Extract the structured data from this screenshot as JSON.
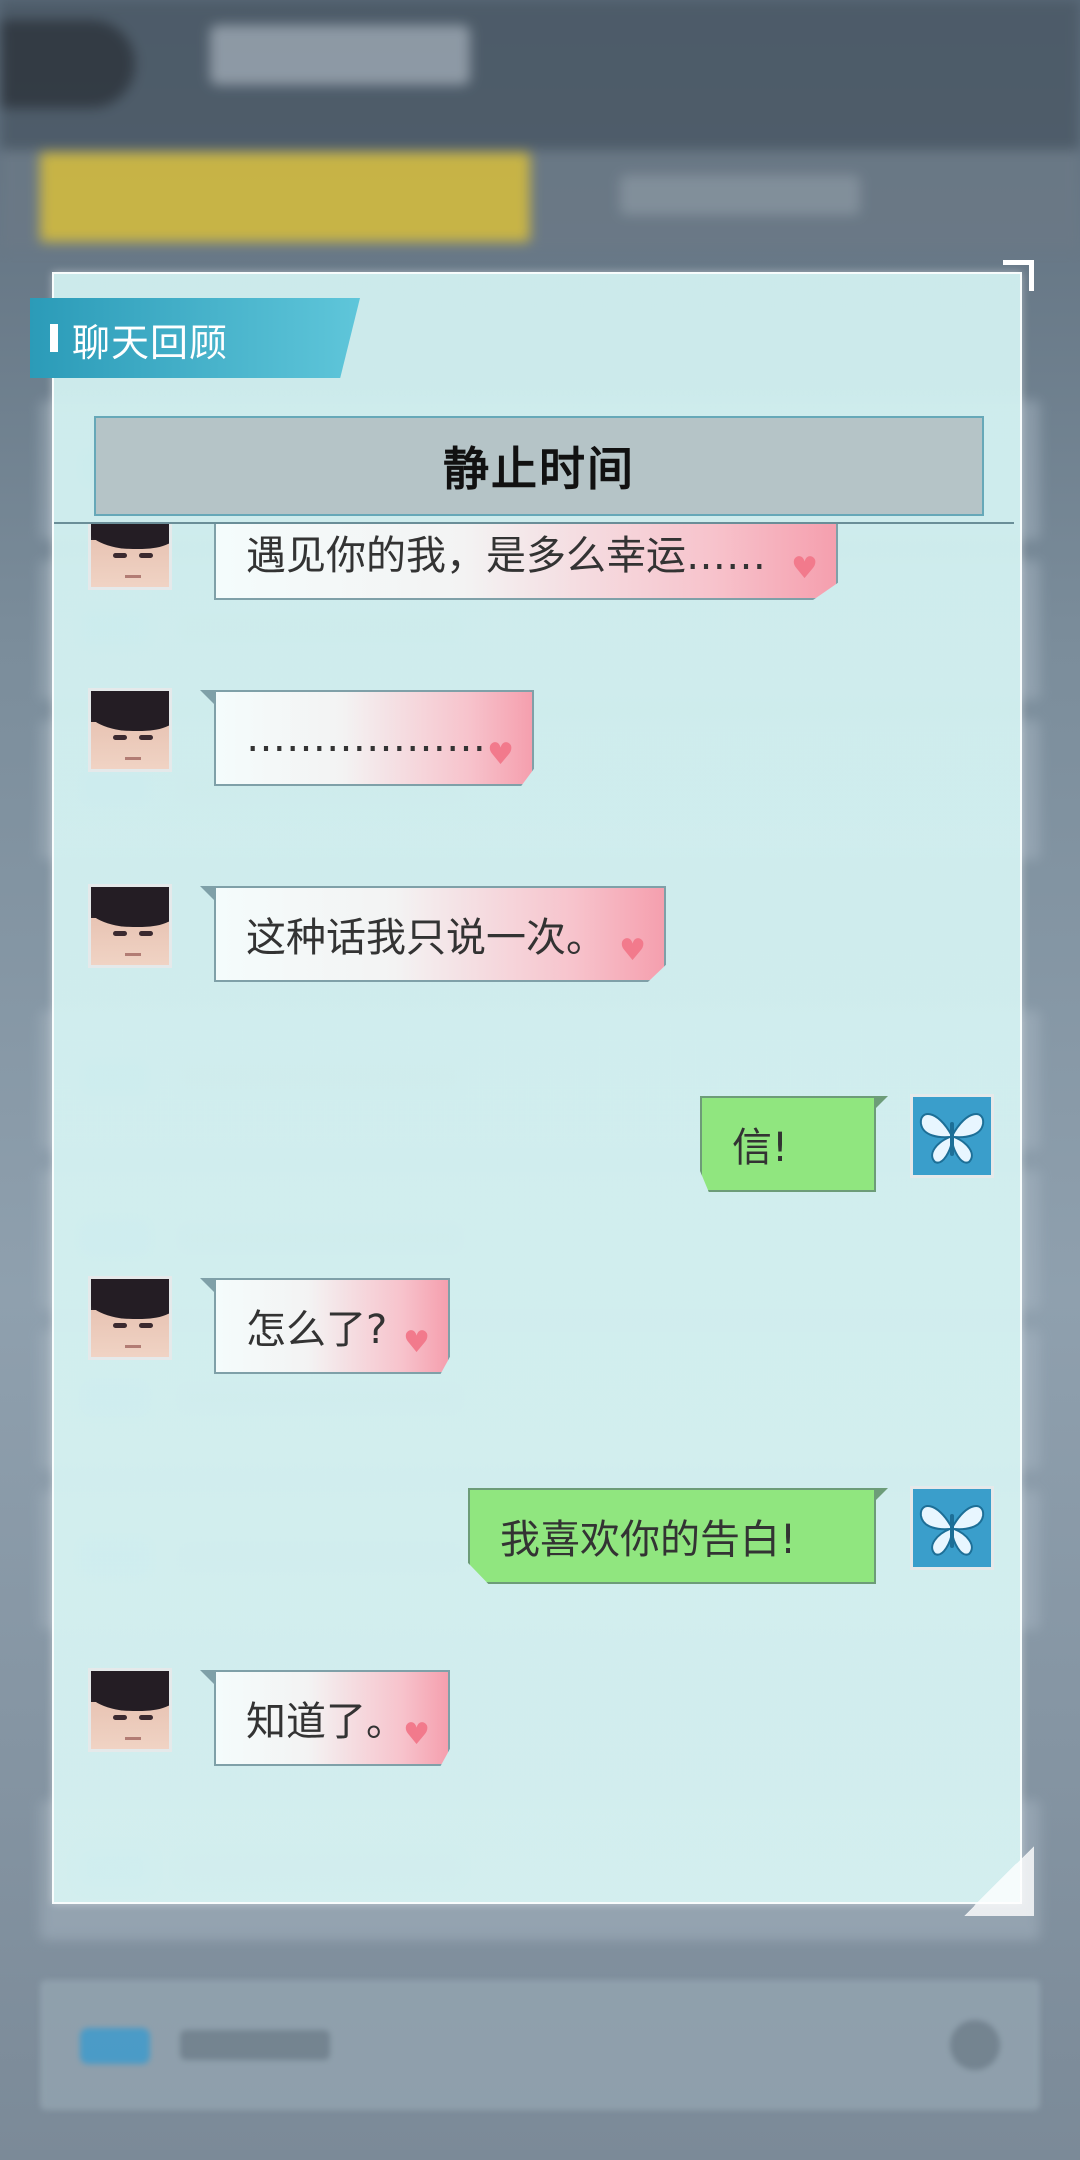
{
  "dialog": {
    "label": "聊天回顾",
    "title": "静止时间"
  },
  "messages": [
    {
      "side": "left",
      "text": "遇见你的我，是多么幸运……"
    },
    {
      "side": "left",
      "text": "………………"
    },
    {
      "side": "left",
      "text": "这种话我只说一次。"
    },
    {
      "side": "right",
      "text": "信!"
    },
    {
      "side": "left",
      "text": "怎么了?"
    },
    {
      "side": "right",
      "text": "我喜欢你的告白!"
    },
    {
      "side": "left",
      "text": "知道了。"
    }
  ],
  "icons": {
    "contact_avatar": "male-portrait-avatar",
    "player_avatar": "butterfly-icon",
    "favorite": "heart-icon"
  },
  "colors": {
    "dialog_bg": "#d4f0f0",
    "label_tag": "#2b9bb8",
    "reply_bubble": "#90e67f",
    "heart": "#f27a8c"
  }
}
